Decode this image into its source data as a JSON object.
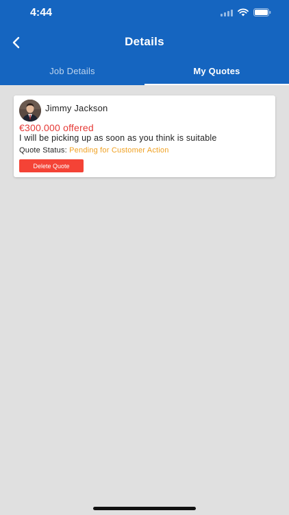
{
  "status_bar": {
    "time": "4:44",
    "icons": [
      "signal-icon",
      "wifi-icon",
      "battery-icon"
    ]
  },
  "header": {
    "title": "Details",
    "back_icon": "chevron-left-icon",
    "background": "#1565c0"
  },
  "tabs": [
    {
      "label": "Job Details",
      "active": false
    },
    {
      "label": "My Quotes",
      "active": true
    }
  ],
  "quote": {
    "customer_name": "Jimmy Jackson",
    "offer": "€300.000 offered",
    "message": "I will be picking up as soon as you think is suitable",
    "status_label": "Quote Status:",
    "status_value": "Pending for Customer Action",
    "delete_label": "Delete Quote"
  },
  "colors": {
    "offer": "#e53935",
    "status_pending": "#f0a020",
    "delete_button": "#f44336"
  }
}
